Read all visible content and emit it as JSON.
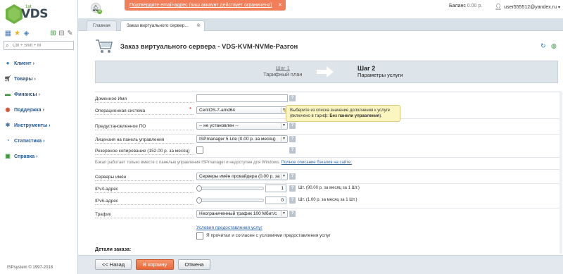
{
  "brand": {
    "name": "VDS",
    "superscript": "1st"
  },
  "sidebar": {
    "search_placeholder": "Ctrl + Shift + M",
    "items": [
      {
        "label": "Клиент",
        "icon": "user-icon",
        "color": "#24578f"
      },
      {
        "label": "Товары",
        "icon": "cart-icon",
        "color": "#24578f"
      },
      {
        "label": "Финансы",
        "icon": "finance-icon",
        "color": "#24578f"
      },
      {
        "label": "Поддержка",
        "icon": "support-icon",
        "color": "#24578f"
      },
      {
        "label": "Инструменты",
        "icon": "tools-icon",
        "color": "#24578f"
      },
      {
        "label": "Статистика",
        "icon": "stats-icon",
        "color": "#24578f"
      },
      {
        "label": "Справка",
        "icon": "help-book-icon",
        "color": "#24578f"
      }
    ],
    "copyright": "ISPsystem © 1997-2018"
  },
  "topbar": {
    "notice": "Подтвердите email-адрес (ваш аккаунт действует ограничено)",
    "notice_close": "✕",
    "balance_label": "Баланс",
    "balance_value": "0.00 р.",
    "user": "user555512@yandex.ru",
    "notification_count": "3"
  },
  "tabs": [
    {
      "label": "Главная"
    },
    {
      "label": "Заказ виртуального сервер..."
    }
  ],
  "page": {
    "title": "Заказ виртуального сервера - VDS-KVM-NVMe-Разгон"
  },
  "wizard": {
    "step1_num": "Шаг 1",
    "step1_title": "Тарифный план",
    "step2_num": "Шаг 2",
    "step2_title": "Параметры услуги"
  },
  "form": {
    "domain": {
      "label": "Доменное Имя",
      "value": ""
    },
    "os": {
      "label": "Операционная система",
      "value": "CentOS-7-amd64"
    },
    "preinstalled": {
      "label": "Предустановленное ПО",
      "value": "-- не установлен --"
    },
    "license": {
      "label": "Лицензия на панель управления",
      "value": "ISPmanager 5 Lite (0.00 р. за месяц)"
    },
    "backup": {
      "label": "Резервное копирование (152.00 р. за месяц)"
    },
    "backup_note": "Бэкап работает только вместе с панелью управления ISPmanager и недоступен для Windows.",
    "backup_link": "Полное описание бэкапов на сайте.",
    "dns": {
      "label": "Серверы имён",
      "value": "Серверы имён провайдера (0.00 р. за"
    },
    "ipv4": {
      "label": "IPv4-адрес",
      "value": "1",
      "suffix": "Шт. (90.00 р. за месяц за 1 Шт.)",
      "level": 0.0
    },
    "ipv6": {
      "label": "IPv6-адрес",
      "value": "0",
      "suffix": "Шт. (1.00 р. за месяц за 1 Шт.)",
      "level": 0.0
    },
    "traffic": {
      "label": "Трафик",
      "value": "Неограниченный трафик 100 Мбит/с"
    },
    "terms_link": "Условия предоставления услуг",
    "agree": "Я прочитал и согласен с условиями предоставления услуг",
    "help": "?"
  },
  "tooltip": {
    "text": "Выберите из списка значение дополнения к услуге (включено в тариф:",
    "bold": "Без панели управления",
    "end": ")."
  },
  "details": "Детали заказа:",
  "buttons": {
    "back": "<< Назад",
    "cart": "В корзину",
    "cancel": "Отмена"
  },
  "colors": {
    "accent": "#e9683a",
    "link": "#2a62a7",
    "nav": "#24578f",
    "brand_green": "#6db33f"
  }
}
